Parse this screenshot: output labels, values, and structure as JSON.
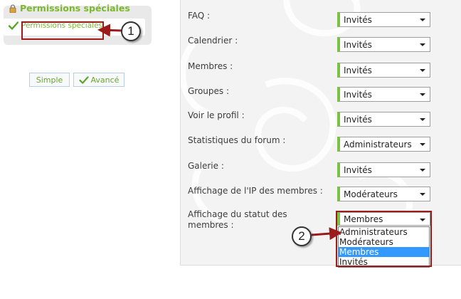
{
  "sidebar": {
    "title": "Permissions spéciales",
    "link": "Permissions spéciales",
    "icons": [
      "lock-icon",
      "checkmark-icon"
    ]
  },
  "modes": {
    "simple_label": "Simple",
    "advanced_label": "Avancé"
  },
  "permissions": [
    {
      "label": "FAQ :",
      "value": "Invités"
    },
    {
      "label": "Calendrier :",
      "value": "Invités"
    },
    {
      "label": "Membres :",
      "value": "Invités"
    },
    {
      "label": "Groupes :",
      "value": "Invités"
    },
    {
      "label": "Voir le profil :",
      "value": "Invités"
    },
    {
      "label": "Statistiques du forum :",
      "value": "Administrateurs"
    },
    {
      "label": "Galerie :",
      "value": "Invités"
    },
    {
      "label": "Affichage de l'IP des membres :",
      "value": "Modérateurs"
    },
    {
      "label_line1": "Affichage du statut des",
      "label_line2": "membres :",
      "value": "Membres"
    }
  ],
  "dropdown_options": [
    "Administrateurs",
    "Modérateurs",
    "Membres",
    "Invités"
  ],
  "dropdown_selected": "Membres",
  "callouts": {
    "one": "1",
    "two": "2"
  },
  "colors": {
    "accent_green": "#7cb82f",
    "callout_red": "#9b1b1b",
    "selection_blue": "#3399ff"
  }
}
